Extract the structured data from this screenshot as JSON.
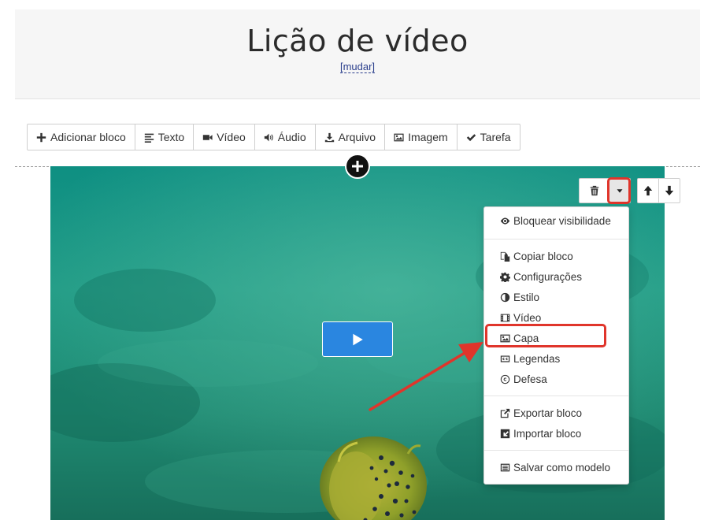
{
  "header": {
    "title": "Lição de vídeo",
    "change_link": "[mudar]"
  },
  "toolbar": {
    "items": [
      {
        "label": "Adicionar bloco",
        "icon": "plus-icon"
      },
      {
        "label": "Texto",
        "icon": "align-left-icon"
      },
      {
        "label": "Vídeo",
        "icon": "video-camera-icon"
      },
      {
        "label": "Áudio",
        "icon": "volume-icon"
      },
      {
        "label": "Arquivo",
        "icon": "download-icon"
      },
      {
        "label": "Imagem",
        "icon": "image-icon"
      },
      {
        "label": "Tarefa",
        "icon": "check-icon"
      }
    ]
  },
  "block_controls": {
    "left": [
      "trash-icon",
      "caret-down-icon"
    ],
    "right": [
      "arrow-up-icon",
      "arrow-down-icon"
    ]
  },
  "dropdown": {
    "groups": [
      [
        {
          "label": "Bloquear visibilidade",
          "icon": "eye-icon"
        }
      ],
      [
        {
          "label": "Copiar bloco",
          "icon": "copy-icon"
        },
        {
          "label": "Configurações",
          "icon": "gear-icon"
        },
        {
          "label": "Estilo",
          "icon": "contrast-icon"
        },
        {
          "label": "Vídeo",
          "icon": "film-icon"
        },
        {
          "label": "Capa",
          "icon": "image-icon"
        },
        {
          "label": "Legendas",
          "icon": "cc-icon"
        },
        {
          "label": "Defesa",
          "icon": "copyright-icon"
        }
      ],
      [
        {
          "label": "Exportar bloco",
          "icon": "external-link-icon"
        },
        {
          "label": "Importar bloco",
          "icon": "import-icon"
        }
      ],
      [
        {
          "label": "Salvar como modelo",
          "icon": "template-icon"
        }
      ]
    ]
  },
  "colors": {
    "accent_blue": "#2a86e0",
    "highlight_red": "#e0352b",
    "video_water": "#1f8f7a"
  }
}
